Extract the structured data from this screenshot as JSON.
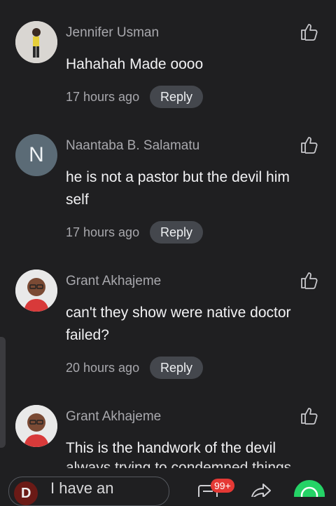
{
  "comments": [
    {
      "name": "Jennifer Usman",
      "text": "Hahahah Made oooo",
      "time": "17 hours ago",
      "reply": "Reply",
      "avatar_type": "photo-woman"
    },
    {
      "name": "Naantaba B. Salamatu",
      "text": "he is not a pastor but the devil him self",
      "time": "17 hours ago",
      "reply": "Reply",
      "avatar_letter": "N"
    },
    {
      "name": "Grant Akhajeme",
      "text": "can't they show were native doctor failed?",
      "time": "20 hours ago",
      "reply": "Reply",
      "avatar_type": "photo-man"
    },
    {
      "name": "Grant Akhajeme",
      "text": "This is the handwork of the devil",
      "partial_text": "always trying to condemned things",
      "avatar_type": "photo-man"
    }
  ],
  "composer": {
    "placeholder": "I have an",
    "avatar_letter": "D"
  },
  "toolbar": {
    "comments_badge": "99+"
  },
  "icons": {
    "like": "thumbs-up-icon",
    "comments": "comments-icon",
    "share": "share-icon",
    "whatsapp": "whatsapp-icon"
  },
  "colors": {
    "background": "#1f1f21",
    "reply_bg": "#44474d",
    "badge": "#e53935",
    "whatsapp": "#25d366"
  }
}
